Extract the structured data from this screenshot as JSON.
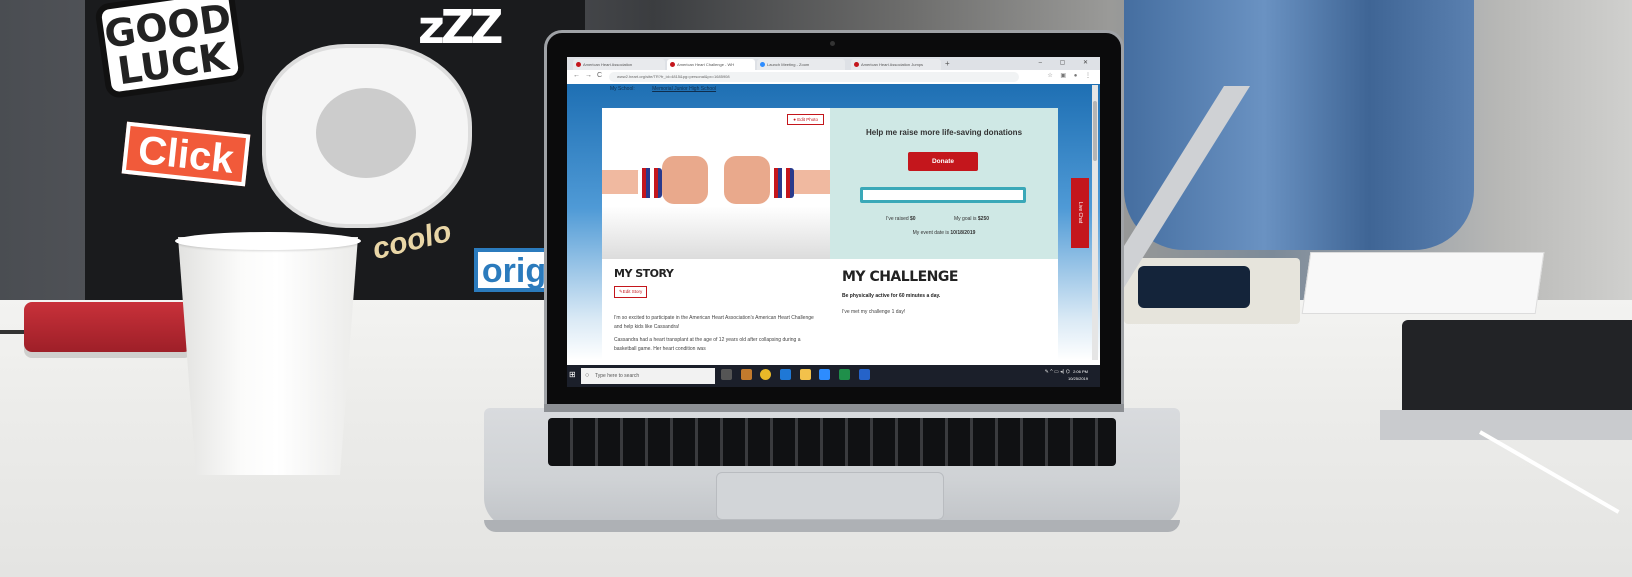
{
  "background_stickers": {
    "good_luck": "GOOD LUCK",
    "zzz": "zZZ",
    "click": "Click",
    "coolo": "coolo",
    "orig": "orig"
  },
  "browser": {
    "tabs": [
      {
        "title": "American Heart Association",
        "active": false
      },
      {
        "title": "American Heart Challenge - WH",
        "active": true
      },
      {
        "title": "Launch Meeting - Zoom",
        "active": false
      },
      {
        "title": "American Heart Association Jumps",
        "active": false
      }
    ],
    "new_tab": "+",
    "window_controls": "– ▢ ✕",
    "url": "www2.heart.org/site/TR?fr_id=4815&pg=personal&px=1685908",
    "nav_back": "←",
    "nav_forward": "→",
    "nav_reload": "C"
  },
  "page": {
    "school_nav": {
      "label": "My School:",
      "school": "Memorial Junior High School"
    },
    "edit_photo": "Edit Photo",
    "donate": {
      "heading": "Help me raise more life-saving donations",
      "button": "Donate",
      "raised_label": "I've raised",
      "raised_value": "$0",
      "goal_label": "My goal is",
      "goal_value": "$250",
      "event_label": "My event date is",
      "event_value": "10/18/2019"
    },
    "story": {
      "heading": "MY STORY",
      "edit": "Edit Story",
      "p1": "I'm so excited to participate in the American Heart Association's American Heart Challenge and help kids like Cassandra!",
      "p2": "Cassandra had a heart transplant at the age of 12 years old after collapsing during a basketball game. Her heart condition was"
    },
    "challenge": {
      "heading": "MY CHALLENGE",
      "subtitle": "Be physically active for 60 minutes a day.",
      "met": "I've met my challenge 1 day!"
    },
    "live_chat": "Live Chat"
  },
  "taskbar": {
    "search_placeholder": "Type here to search",
    "time": "2:06 PM",
    "date": "10/25/2019"
  },
  "colors": {
    "brand_red": "#c4161c",
    "page_blue": "#1e6fb3",
    "donate_panel": "#cfe8e5"
  }
}
